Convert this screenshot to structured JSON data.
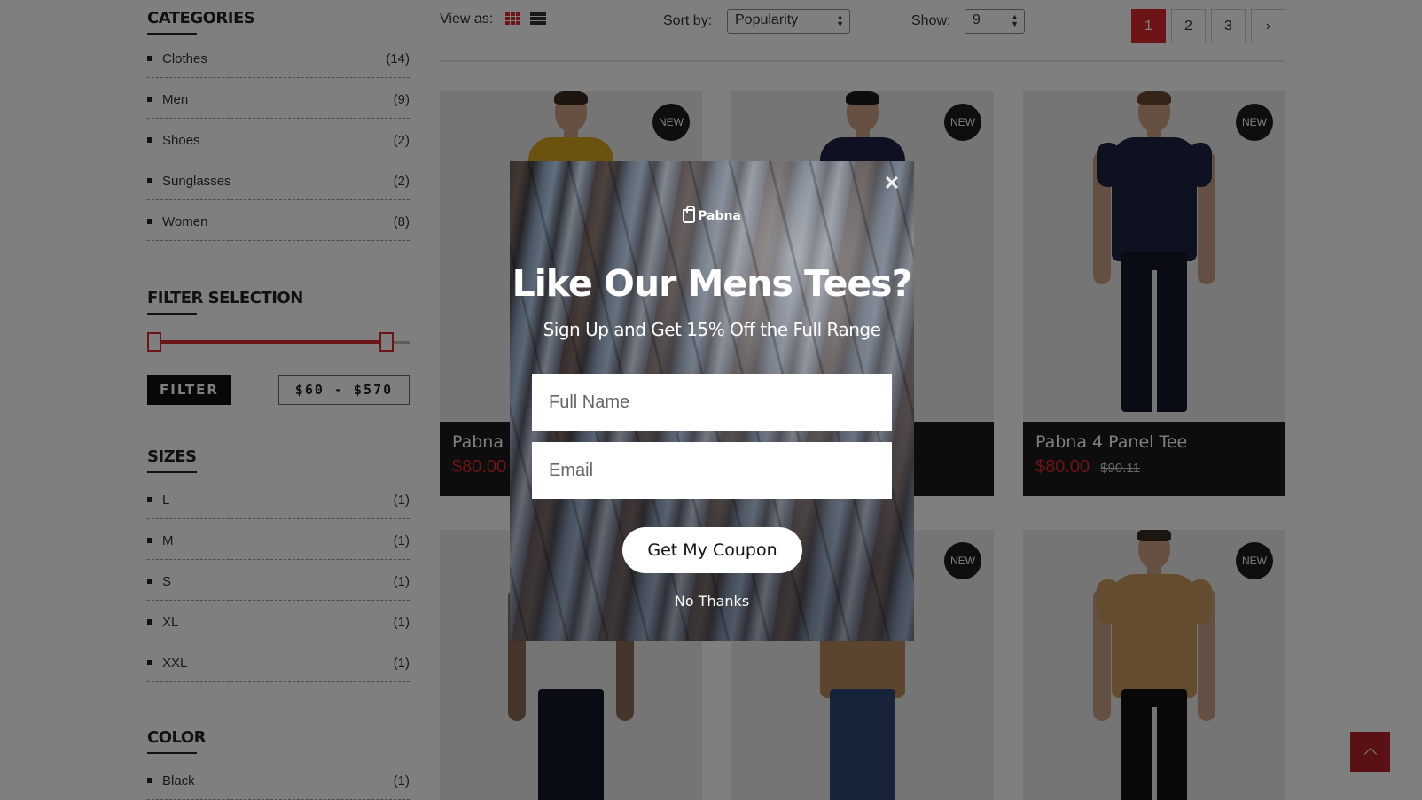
{
  "sidebar": {
    "categories": {
      "title": "CATEGORIES",
      "items": [
        {
          "label": "Clothes",
          "count": "(14)"
        },
        {
          "label": "Men",
          "count": "(9)"
        },
        {
          "label": "Shoes",
          "count": "(2)"
        },
        {
          "label": "Sunglasses",
          "count": "(2)"
        },
        {
          "label": "Women",
          "count": "(8)"
        }
      ]
    },
    "filter": {
      "title": "FILTER SELECTION",
      "button_label": "FILTER",
      "price_range": "$60 - $570",
      "slider_min_fraction": 0.0,
      "slider_max_fraction": 1.0
    },
    "sizes": {
      "title": "SIZES",
      "items": [
        {
          "label": "L",
          "count": "(1)"
        },
        {
          "label": "M",
          "count": "(1)"
        },
        {
          "label": "S",
          "count": "(1)"
        },
        {
          "label": "XL",
          "count": "(1)"
        },
        {
          "label": "XXL",
          "count": "(1)"
        }
      ]
    },
    "color": {
      "title": "COLOR",
      "items": [
        {
          "label": "Black",
          "count": "(1)"
        }
      ]
    }
  },
  "toolbar": {
    "view_as_label": "View as:",
    "sort_label": "Sort by:",
    "sort_value": "Popularity",
    "show_label": "Show:",
    "show_value": "9",
    "pages": [
      "1",
      "2",
      "3"
    ],
    "active_page": "1",
    "next_icon": "chevron-right-icon"
  },
  "products": [
    {
      "badge": "NEW",
      "name": "Pabna",
      "price": "$80.00",
      "old_price": "",
      "shirt": "#d9a41e"
    },
    {
      "badge": "NEW",
      "name": "",
      "price": "",
      "old_price": "",
      "shirt": "#1e2246"
    },
    {
      "badge": "NEW",
      "name": "Pabna 4 Panel Tee",
      "price": "$80.00",
      "old_price": "$90.11",
      "shirt": "#1b2240"
    },
    {
      "badge": "",
      "name": "",
      "price": "",
      "old_price": "",
      "shirt": "#e8e8e8"
    },
    {
      "badge": "NEW",
      "name": "",
      "price": "",
      "old_price": "",
      "shirt": "#b78a5c"
    },
    {
      "badge": "NEW",
      "name": "",
      "price": "",
      "old_price": "",
      "shirt": "#c89a5e"
    }
  ],
  "popup": {
    "brand": "Pabna",
    "title": "Like Our Mens Tees?",
    "subtitle": "Sign Up and Get 15% Off the Full Range",
    "name_placeholder": "Full Name",
    "email_placeholder": "Email",
    "cta": "Get My Coupon",
    "dismiss": "No Thanks",
    "close_icon": "close-icon"
  },
  "colors": {
    "accent": "#d9282c",
    "dark": "#1a1a1a"
  }
}
